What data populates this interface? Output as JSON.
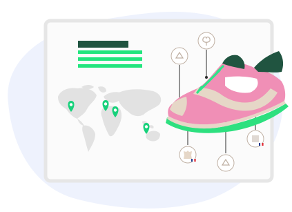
{
  "colors": {
    "blob": "#eef2fd",
    "card_bg": "#fbfbfb",
    "card_border": "#e6e6e6",
    "heading_bar": "#205440",
    "text_lines": "#22e57e",
    "map": "#e2e2e2",
    "pin": "#17d17b",
    "shoe_pink": "#f08fb6",
    "shoe_beige": "#e6d7c7",
    "shoe_dark": "#205440",
    "shoe_sole": "#2de07f",
    "shoe_laces": "#2fe389",
    "callout_line": "#2b2b2b",
    "icon_stroke": "#bfb0a3",
    "icon_fill": "#ffffff"
  },
  "card": {
    "text_placeholder_lines": 3
  },
  "map": {
    "pins": [
      {
        "name": "map-pin-west-africa"
      },
      {
        "name": "map-pin-middle-east"
      },
      {
        "name": "map-pin-india"
      },
      {
        "name": "map-pin-southeast-asia"
      }
    ]
  },
  "callouts": [
    {
      "name": "recycle-icon",
      "flag": ""
    },
    {
      "name": "cotton-icon",
      "flag": ""
    },
    {
      "name": "leather-icon",
      "flag": "france"
    },
    {
      "name": "recycle-sole-icon",
      "flag": ""
    },
    {
      "name": "fabric-mesh-icon",
      "flag": "france"
    }
  ]
}
